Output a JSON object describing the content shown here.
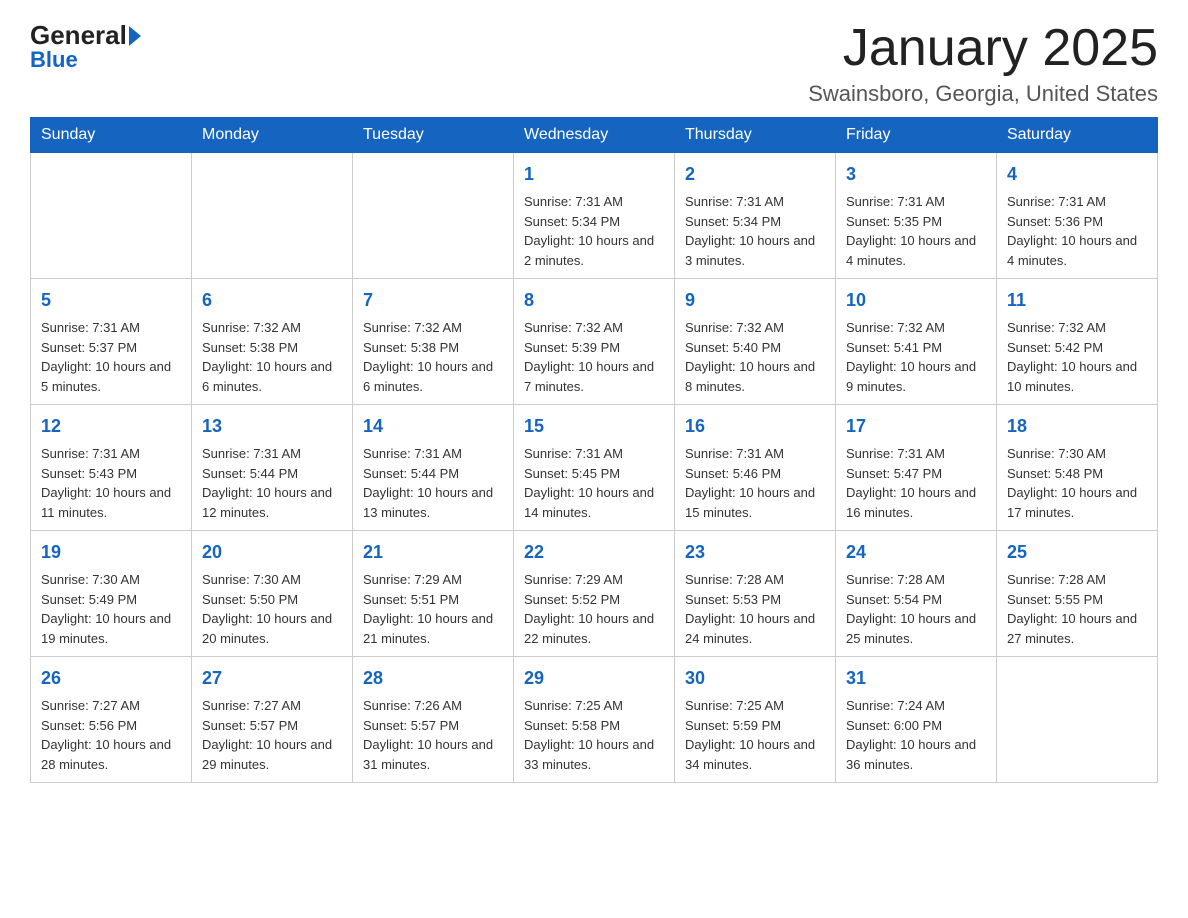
{
  "logo": {
    "general": "General",
    "blue": "Blue",
    "sub": "Blue"
  },
  "title": "January 2025",
  "subtitle": "Swainsboro, Georgia, United States",
  "days_of_week": [
    "Sunday",
    "Monday",
    "Tuesday",
    "Wednesday",
    "Thursday",
    "Friday",
    "Saturday"
  ],
  "weeks": [
    [
      {
        "day": "",
        "info": ""
      },
      {
        "day": "",
        "info": ""
      },
      {
        "day": "",
        "info": ""
      },
      {
        "day": "1",
        "info": "Sunrise: 7:31 AM\nSunset: 5:34 PM\nDaylight: 10 hours and 2 minutes."
      },
      {
        "day": "2",
        "info": "Sunrise: 7:31 AM\nSunset: 5:34 PM\nDaylight: 10 hours and 3 minutes."
      },
      {
        "day": "3",
        "info": "Sunrise: 7:31 AM\nSunset: 5:35 PM\nDaylight: 10 hours and 4 minutes."
      },
      {
        "day": "4",
        "info": "Sunrise: 7:31 AM\nSunset: 5:36 PM\nDaylight: 10 hours and 4 minutes."
      }
    ],
    [
      {
        "day": "5",
        "info": "Sunrise: 7:31 AM\nSunset: 5:37 PM\nDaylight: 10 hours and 5 minutes."
      },
      {
        "day": "6",
        "info": "Sunrise: 7:32 AM\nSunset: 5:38 PM\nDaylight: 10 hours and 6 minutes."
      },
      {
        "day": "7",
        "info": "Sunrise: 7:32 AM\nSunset: 5:38 PM\nDaylight: 10 hours and 6 minutes."
      },
      {
        "day": "8",
        "info": "Sunrise: 7:32 AM\nSunset: 5:39 PM\nDaylight: 10 hours and 7 minutes."
      },
      {
        "day": "9",
        "info": "Sunrise: 7:32 AM\nSunset: 5:40 PM\nDaylight: 10 hours and 8 minutes."
      },
      {
        "day": "10",
        "info": "Sunrise: 7:32 AM\nSunset: 5:41 PM\nDaylight: 10 hours and 9 minutes."
      },
      {
        "day": "11",
        "info": "Sunrise: 7:32 AM\nSunset: 5:42 PM\nDaylight: 10 hours and 10 minutes."
      }
    ],
    [
      {
        "day": "12",
        "info": "Sunrise: 7:31 AM\nSunset: 5:43 PM\nDaylight: 10 hours and 11 minutes."
      },
      {
        "day": "13",
        "info": "Sunrise: 7:31 AM\nSunset: 5:44 PM\nDaylight: 10 hours and 12 minutes."
      },
      {
        "day": "14",
        "info": "Sunrise: 7:31 AM\nSunset: 5:44 PM\nDaylight: 10 hours and 13 minutes."
      },
      {
        "day": "15",
        "info": "Sunrise: 7:31 AM\nSunset: 5:45 PM\nDaylight: 10 hours and 14 minutes."
      },
      {
        "day": "16",
        "info": "Sunrise: 7:31 AM\nSunset: 5:46 PM\nDaylight: 10 hours and 15 minutes."
      },
      {
        "day": "17",
        "info": "Sunrise: 7:31 AM\nSunset: 5:47 PM\nDaylight: 10 hours and 16 minutes."
      },
      {
        "day": "18",
        "info": "Sunrise: 7:30 AM\nSunset: 5:48 PM\nDaylight: 10 hours and 17 minutes."
      }
    ],
    [
      {
        "day": "19",
        "info": "Sunrise: 7:30 AM\nSunset: 5:49 PM\nDaylight: 10 hours and 19 minutes."
      },
      {
        "day": "20",
        "info": "Sunrise: 7:30 AM\nSunset: 5:50 PM\nDaylight: 10 hours and 20 minutes."
      },
      {
        "day": "21",
        "info": "Sunrise: 7:29 AM\nSunset: 5:51 PM\nDaylight: 10 hours and 21 minutes."
      },
      {
        "day": "22",
        "info": "Sunrise: 7:29 AM\nSunset: 5:52 PM\nDaylight: 10 hours and 22 minutes."
      },
      {
        "day": "23",
        "info": "Sunrise: 7:28 AM\nSunset: 5:53 PM\nDaylight: 10 hours and 24 minutes."
      },
      {
        "day": "24",
        "info": "Sunrise: 7:28 AM\nSunset: 5:54 PM\nDaylight: 10 hours and 25 minutes."
      },
      {
        "day": "25",
        "info": "Sunrise: 7:28 AM\nSunset: 5:55 PM\nDaylight: 10 hours and 27 minutes."
      }
    ],
    [
      {
        "day": "26",
        "info": "Sunrise: 7:27 AM\nSunset: 5:56 PM\nDaylight: 10 hours and 28 minutes."
      },
      {
        "day": "27",
        "info": "Sunrise: 7:27 AM\nSunset: 5:57 PM\nDaylight: 10 hours and 29 minutes."
      },
      {
        "day": "28",
        "info": "Sunrise: 7:26 AM\nSunset: 5:57 PM\nDaylight: 10 hours and 31 minutes."
      },
      {
        "day": "29",
        "info": "Sunrise: 7:25 AM\nSunset: 5:58 PM\nDaylight: 10 hours and 33 minutes."
      },
      {
        "day": "30",
        "info": "Sunrise: 7:25 AM\nSunset: 5:59 PM\nDaylight: 10 hours and 34 minutes."
      },
      {
        "day": "31",
        "info": "Sunrise: 7:24 AM\nSunset: 6:00 PM\nDaylight: 10 hours and 36 minutes."
      },
      {
        "day": "",
        "info": ""
      }
    ]
  ]
}
